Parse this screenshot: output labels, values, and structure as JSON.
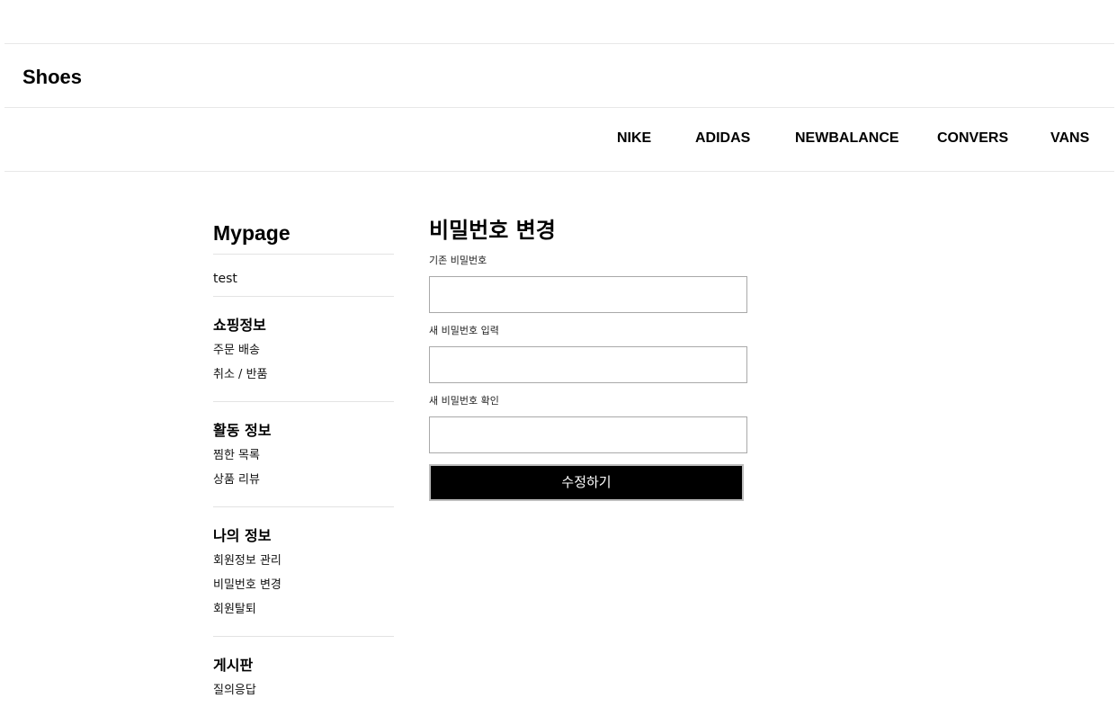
{
  "header": {
    "brand": "Shoes"
  },
  "nav": {
    "items": [
      {
        "label": "NIKE"
      },
      {
        "label": "ADIDAS"
      },
      {
        "label": "NEWBALANCE"
      },
      {
        "label": "CONVERS"
      },
      {
        "label": "VANS"
      }
    ]
  },
  "sidebar": {
    "title": "Mypage",
    "username": "test",
    "sections": [
      {
        "heading": "쇼핑정보",
        "items": [
          "주문 배송",
          "취소 / 반품"
        ]
      },
      {
        "heading": "활동 정보",
        "items": [
          "찜한 목록",
          "상품 리뷰"
        ]
      },
      {
        "heading": "나의 정보",
        "items": [
          "회원정보 관리",
          "비밀번호 변경",
          "회원탈퇴"
        ]
      },
      {
        "heading": "게시판",
        "items": [
          "질의응답"
        ]
      }
    ]
  },
  "form": {
    "title": "비밀번호 변경",
    "current_label": "기존 비밀번호",
    "current_value": "",
    "new_label": "새 비밀번호 입력",
    "new_value": "",
    "confirm_label": "새 비밀번호 확인",
    "confirm_value": "",
    "submit_label": "수정하기"
  }
}
